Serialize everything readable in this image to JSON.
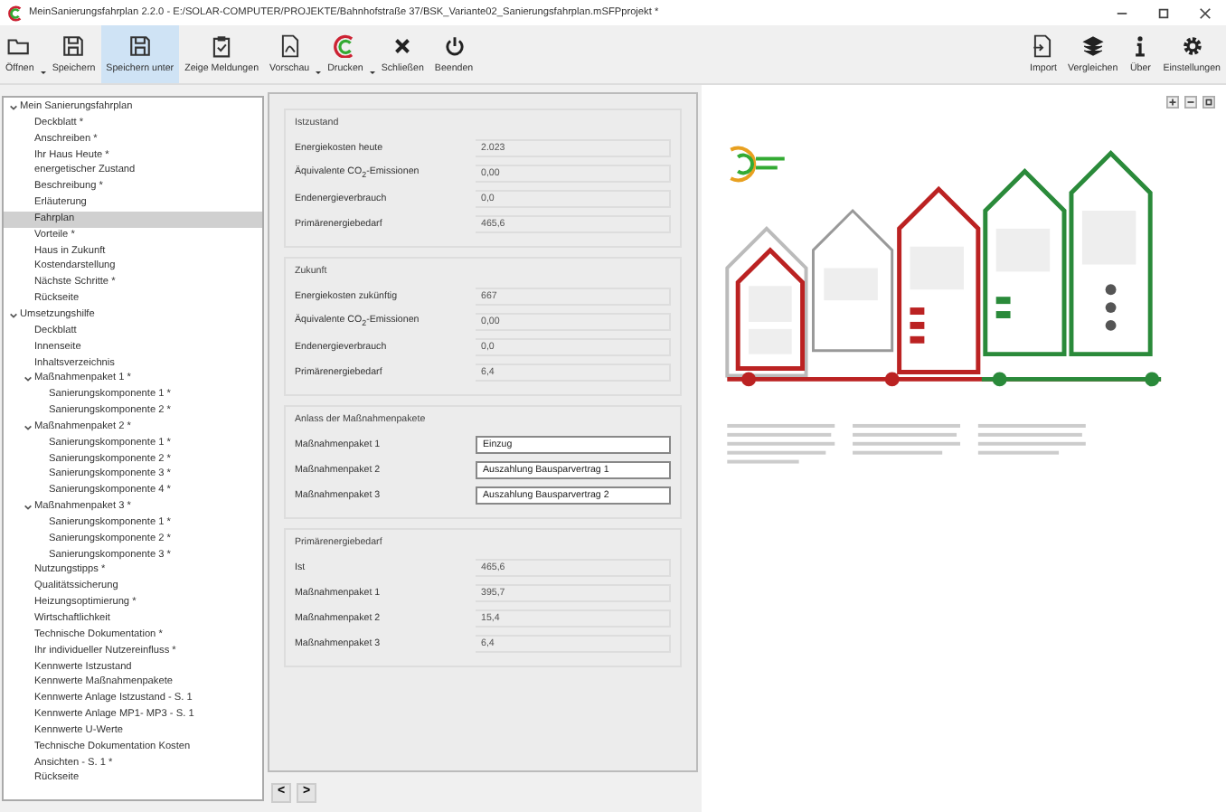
{
  "window": {
    "title": "MeinSanierungsfahrplan 2.2.0 - E:/SOLAR-COMPUTER/PROJEKTE/Bahnhofstraße 37/BSK_Variante02_Sanierungsfahrplan.mSFPprojekt *"
  },
  "toolbar": {
    "left": [
      {
        "label": "Öffnen",
        "kind": "folder",
        "selected": false,
        "dropdown": true
      },
      {
        "label": "Speichern",
        "kind": "save",
        "selected": false,
        "dropdown": false
      },
      {
        "label": "Speichern unter",
        "kind": "save",
        "selected": true,
        "dropdown": false
      },
      {
        "label": "Zeige Meldungen",
        "kind": "clipboard",
        "selected": false,
        "dropdown": false
      },
      {
        "label": "Vorschau",
        "kind": "document",
        "selected": false,
        "dropdown": true
      },
      {
        "label": "Drucken",
        "kind": "arcs",
        "selected": false,
        "dropdown": true
      },
      {
        "label": "Schließen",
        "kind": "close",
        "selected": false,
        "dropdown": false
      },
      {
        "label": "Beenden",
        "kind": "power",
        "selected": false,
        "dropdown": false
      }
    ],
    "right": [
      {
        "label": "Import",
        "kind": "import",
        "selected": false,
        "dropdown": false
      },
      {
        "label": "Vergleichen",
        "kind": "layers",
        "selected": false,
        "dropdown": false
      },
      {
        "label": "Über",
        "kind": "info",
        "selected": false,
        "dropdown": false
      },
      {
        "label": "Einstellungen",
        "kind": "gear",
        "selected": false,
        "dropdown": false
      }
    ]
  },
  "tree": [
    {
      "label": "Mein Sanierungsfahrplan",
      "expanded": true,
      "selected": false,
      "children": [
        {
          "label": "Deckblatt *",
          "selected": false
        },
        {
          "label": "Anschreiben *",
          "selected": false
        },
        {
          "label": "Ihr Haus Heute *",
          "selected": false
        },
        {
          "label": "energetischer Zustand",
          "selected": false
        },
        {
          "label": "Beschreibung *",
          "selected": false
        },
        {
          "label": "Erläuterung",
          "selected": false
        },
        {
          "label": "Fahrplan",
          "selected": true
        },
        {
          "label": "Vorteile *",
          "selected": false
        },
        {
          "label": "Haus in Zukunft",
          "selected": false
        },
        {
          "label": "Kostendarstellung",
          "selected": false
        },
        {
          "label": "Nächste Schritte *",
          "selected": false
        },
        {
          "label": "Rückseite",
          "selected": false
        }
      ]
    },
    {
      "label": "Umsetzungshilfe",
      "expanded": true,
      "selected": false,
      "children": [
        {
          "label": "Deckblatt",
          "selected": false
        },
        {
          "label": "Innenseite",
          "selected": false
        },
        {
          "label": "Inhaltsverzeichnis",
          "selected": false
        },
        {
          "label": "Maßnahmenpaket 1 *",
          "expanded": true,
          "selected": false,
          "children": [
            {
              "label": "Sanierungskomponente 1 *",
              "selected": false
            },
            {
              "label": "Sanierungskomponente 2 *",
              "selected": false
            }
          ]
        },
        {
          "label": "Maßnahmenpaket 2 *",
          "expanded": true,
          "selected": false,
          "children": [
            {
              "label": "Sanierungskomponente 1 *",
              "selected": false
            },
            {
              "label": "Sanierungskomponente 2 *",
              "selected": false
            },
            {
              "label": "Sanierungskomponente 3 *",
              "selected": false
            },
            {
              "label": "Sanierungskomponente 4 *",
              "selected": false
            }
          ]
        },
        {
          "label": "Maßnahmenpaket 3 *",
          "expanded": true,
          "selected": false,
          "children": [
            {
              "label": "Sanierungskomponente 1 *",
              "selected": false
            },
            {
              "label": "Sanierungskomponente 2 *",
              "selected": false
            },
            {
              "label": "Sanierungskomponente 3 *",
              "selected": false
            }
          ]
        },
        {
          "label": "Nutzungstipps *",
          "selected": false
        },
        {
          "label": "Qualitätssicherung",
          "selected": false
        },
        {
          "label": "Heizungsoptimierung *",
          "selected": false
        },
        {
          "label": "Wirtschaftlichkeit",
          "selected": false
        },
        {
          "label": "Technische Dokumentation *",
          "selected": false
        },
        {
          "label": "Ihr individueller Nutzereinfluss *",
          "selected": false
        },
        {
          "label": "Kennwerte Istzustand",
          "selected": false
        },
        {
          "label": "Kennwerte Maßnahmenpakete",
          "selected": false
        },
        {
          "label": "Kennwerte Anlage Istzustand - S. 1",
          "selected": false
        },
        {
          "label": "Kennwerte Anlage MP1- MP3 - S. 1",
          "selected": false
        },
        {
          "label": "Kennwerte U-Werte",
          "selected": false
        },
        {
          "label": "Technische Dokumentation Kosten",
          "selected": false
        },
        {
          "label": "Ansichten - S. 1 *",
          "selected": false
        },
        {
          "label": "Rückseite",
          "selected": false
        }
      ]
    }
  ],
  "groups": [
    {
      "title": "Istzustand",
      "rows": [
        {
          "label": "Energiekosten heute",
          "value": "2.023",
          "editable": false
        },
        {
          "label": "Äquivalente CO$_{2}$-Emissionen",
          "value": "0,00",
          "editable": false
        },
        {
          "label": "Endenergieverbrauch",
          "value": "0,0",
          "editable": false
        },
        {
          "label": "Primärenergiebedarf",
          "value": "465,6",
          "editable": false
        }
      ]
    },
    {
      "title": "Zukunft",
      "rows": [
        {
          "label": "Energiekosten zukünftig",
          "value": "667",
          "editable": false
        },
        {
          "label": "Äquivalente CO$_{2}$-Emissionen",
          "value": "0,00",
          "editable": false
        },
        {
          "label": "Endenergieverbrauch",
          "value": "0,0",
          "editable": false
        },
        {
          "label": "Primärenergiebedarf",
          "value": "6,4",
          "editable": false
        }
      ]
    },
    {
      "title": "Anlass der Maßnahmenpakete",
      "rows": [
        {
          "label": "Maßnahmenpaket 1",
          "value": "Einzug",
          "editable": true
        },
        {
          "label": "Maßnahmenpaket 2",
          "value": "Auszahlung Bausparvertrag 1",
          "editable": true
        },
        {
          "label": "Maßnahmenpaket 3",
          "value": "Auszahlung Bausparvertrag 2",
          "editable": true
        }
      ]
    },
    {
      "title": "Primärenergiebedarf",
      "rows": [
        {
          "label": "Ist",
          "value": "465,6",
          "editable": false
        },
        {
          "label": "Maßnahmenpaket 1",
          "value": "395,7",
          "editable": false
        },
        {
          "label": "Maßnahmenpaket 2",
          "value": "15,4",
          "editable": false
        },
        {
          "label": "Maßnahmenpaket 3",
          "value": "6,4",
          "editable": false
        }
      ]
    }
  ],
  "navigation": {
    "previous": "<",
    "next": ">"
  }
}
